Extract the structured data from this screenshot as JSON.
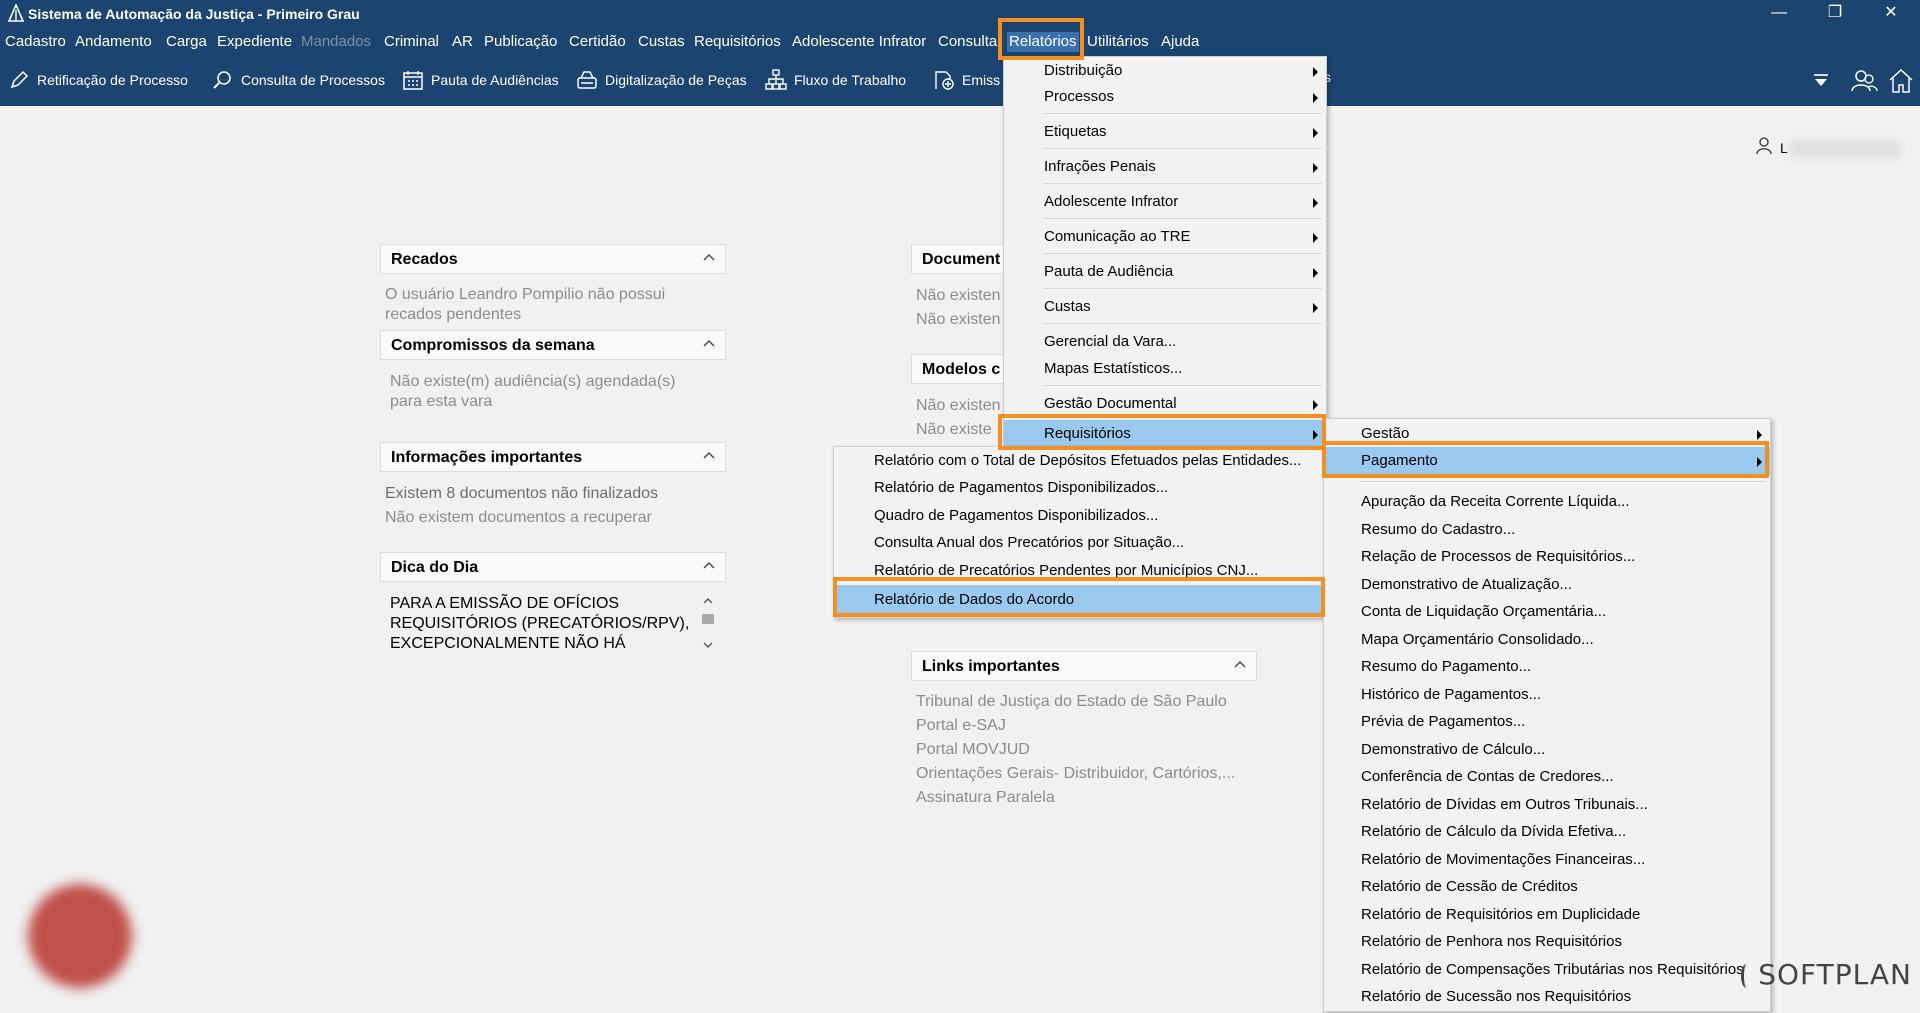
{
  "window": {
    "title": "Sistema de Automação da Justiça - Primeiro Grau",
    "controls": [
      "—",
      "❐",
      "✕"
    ]
  },
  "menubar": [
    {
      "label": "Cadastro"
    },
    {
      "label": "Andamento"
    },
    {
      "label": "Carga"
    },
    {
      "label": "Expediente"
    },
    {
      "label": "Mandados"
    },
    {
      "label": "Criminal"
    },
    {
      "label": "AR"
    },
    {
      "label": "Publicação"
    },
    {
      "label": "Certidão"
    },
    {
      "label": "Custas"
    },
    {
      "label": "Requisitórios"
    },
    {
      "label": "Adolescente Infrator"
    },
    {
      "label": "Consulta"
    },
    {
      "label": "Relatórios"
    },
    {
      "label": "Utilitários"
    },
    {
      "label": "Ajuda"
    }
  ],
  "toolbar": [
    {
      "label": "Retificação de Processo",
      "icon": "edit-icon"
    },
    {
      "label": "Consulta de Processos",
      "icon": "search-icon"
    },
    {
      "label": "Pauta de Audiências",
      "icon": "calendar-icon"
    },
    {
      "label": "Digitalização de Peças",
      "icon": "scanner-icon"
    },
    {
      "label": "Fluxo de Trabalho",
      "icon": "workflow-icon"
    },
    {
      "label": "Emiss",
      "icon": "emission-icon"
    },
    {
      "label": "s"
    }
  ],
  "user": {
    "label": "L"
  },
  "widgets": {
    "recados": {
      "title": "Recados",
      "lines": [
        "O usuário Leandro Pompilio não possui",
        "recados pendentes"
      ]
    },
    "compromissos": {
      "title": "Compromissos da semana",
      "lines": [
        "Não existe(m) audiência(s) agendada(s)",
        "para esta vara"
      ]
    },
    "informacoes": {
      "title": "Informações importantes",
      "lines": [
        "Existem 8 documentos não finalizados",
        "Não existem documentos a recuperar"
      ]
    },
    "dica": {
      "title": "Dica do Dia",
      "lines": [
        "PARA A EMISSÃO DE OFÍCIOS",
        "REQUISITÓRIOS (PRECATÓRIOS/RPV),",
        "EXCEPCIONALMENTE NÃO HÁ"
      ]
    },
    "documentos": {
      "title": "Document",
      "lines": [
        "Não existen",
        "Não existen"
      ]
    },
    "modelos": {
      "title": "Modelos c",
      "lines": [
        "Não existen",
        "Não existe"
      ]
    },
    "links": {
      "title": "Links importantes",
      "lines": [
        "Tribunal de Justiça do Estado de São Paulo",
        "Portal e-SAJ",
        "Portal MOVJUD",
        "Orientações Gerais- Distribuidor, Cartórios,...",
        "Assinatura Paralela"
      ]
    }
  },
  "relatorios_menu": [
    {
      "label": "Distribuição",
      "sub": true
    },
    {
      "label": "Processos",
      "sub": true
    },
    {
      "label": "Etiquetas",
      "sub": true
    },
    {
      "label": "Infrações Penais",
      "sub": true
    },
    {
      "label": "Adolescente Infrator",
      "sub": true
    },
    {
      "label": "Comunicação ao TRE",
      "sub": true
    },
    {
      "label": "Pauta de Audiência",
      "sub": true
    },
    {
      "label": "Custas",
      "sub": true
    },
    {
      "label": "Gerencial da Vara...",
      "sub": false
    },
    {
      "label": "Mapas Estatísticos...",
      "sub": false
    },
    {
      "label": "Gestão Documental",
      "sub": true
    },
    {
      "label": "Requisitórios",
      "sub": true
    }
  ],
  "requisitorios_left_menu": [
    "Relatório com o Total de Depósitos Efetuados pelas Entidades...",
    "Relatório de Pagamentos Disponibilizados...",
    "Quadro de Pagamentos Disponibilizados...",
    "Consulta Anual dos Precatórios por Situação...",
    "Relatório de Precatórios Pendentes por Municípios CNJ...",
    "Relatório de Dados do Acordo"
  ],
  "requisitorios_right_menu": [
    {
      "label": "Gestão",
      "sub": true
    },
    {
      "label": "Pagamento",
      "sub": true
    }
  ],
  "pagamento_items": [
    "Apuração da Receita Corrente Líquida...",
    "Resumo do Cadastro...",
    "Relação de Processos de Requisitórios...",
    "Demonstrativo de Atualização...",
    "Conta de Liquidação Orçamentária...",
    "Mapa Orçamentário Consolidado...",
    "Resumo do Pagamento...",
    "Histórico de Pagamentos...",
    "Prévia de Pagamentos...",
    "Demonstrativo de Cálculo...",
    "Conferência de Contas de Credores...",
    "Relatório de Dívidas em Outros Tribunais...",
    "Relatório de Cálculo da Dívida Efetiva...",
    "Relatório de Movimentações Financeiras...",
    "Relatório de Cessão de Créditos",
    "Relatório de Requisitórios em Duplicidade",
    "Relatório de Penhora nos Requisitórios",
    "Relatório de Compensações Tributárias nos Requisitórios",
    "Relatório de Sucessão nos Requisitórios"
  ],
  "brand": "SOFTPLAN",
  "colors": {
    "chrome": "#1b4470",
    "highlight": "#f39021",
    "selection": "#99c9ef"
  }
}
